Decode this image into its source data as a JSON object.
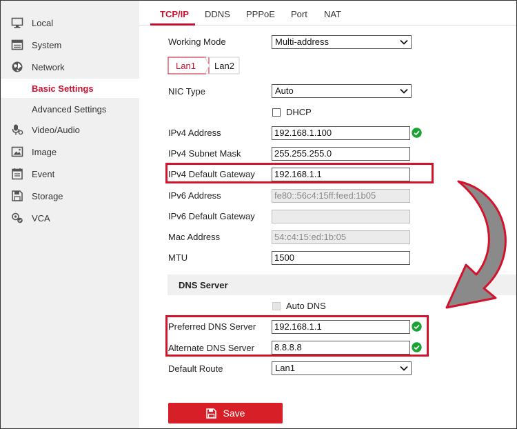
{
  "sidebar": {
    "items": [
      {
        "label": "Local",
        "icon": "monitor-icon"
      },
      {
        "label": "System",
        "icon": "system-icon"
      },
      {
        "label": "Network",
        "icon": "globe-icon"
      },
      {
        "label": "Video/Audio",
        "icon": "microphone-icon"
      },
      {
        "label": "Image",
        "icon": "image-icon"
      },
      {
        "label": "Event",
        "icon": "event-icon"
      },
      {
        "label": "Storage",
        "icon": "storage-icon"
      },
      {
        "label": "VCA",
        "icon": "vca-icon"
      }
    ],
    "sub_items": [
      {
        "label": "Basic Settings",
        "active": true
      },
      {
        "label": "Advanced Settings",
        "active": false
      }
    ]
  },
  "tabs": [
    "TCP/IP",
    "DDNS",
    "PPPoE",
    "Port",
    "NAT"
  ],
  "form": {
    "working_mode": {
      "label": "Working Mode",
      "value": "Multi-address"
    },
    "lan_tabs": [
      "Lan1",
      "Lan2"
    ],
    "nic_type": {
      "label": "NIC Type",
      "value": "Auto"
    },
    "dhcp": {
      "label": "DHCP",
      "checked": false
    },
    "ipv4_address": {
      "label": "IPv4 Address",
      "value": "192.168.1.100"
    },
    "ipv4_subnet": {
      "label": "IPv4 Subnet Mask",
      "value": "255.255.255.0"
    },
    "ipv4_gateway": {
      "label": "IPv4 Default Gateway",
      "value": "192.168.1.1"
    },
    "ipv6_address": {
      "label": "IPv6 Address",
      "value": "fe80::56c4:15ff:feed:1b05"
    },
    "ipv6_gateway": {
      "label": "IPv6 Default Gateway",
      "value": ""
    },
    "mac_address": {
      "label": "Mac Address",
      "value": "54:c4:15:ed:1b:05"
    },
    "mtu": {
      "label": "MTU",
      "value": "1500"
    },
    "dns_section": "DNS Server",
    "auto_dns": {
      "label": "Auto DNS",
      "checked": false
    },
    "preferred_dns": {
      "label": "Preferred DNS Server",
      "value": "192.168.1.1"
    },
    "alternate_dns": {
      "label": "Alternate DNS Server",
      "value": "8.8.8.8"
    },
    "default_route": {
      "label": "Default Route",
      "value": "Lan1"
    }
  },
  "save_label": "Save",
  "colors": {
    "accent": "#c8102e",
    "ok": "#1aa335",
    "highlight": "#d3132c",
    "arrow": "#8a8a8a"
  }
}
